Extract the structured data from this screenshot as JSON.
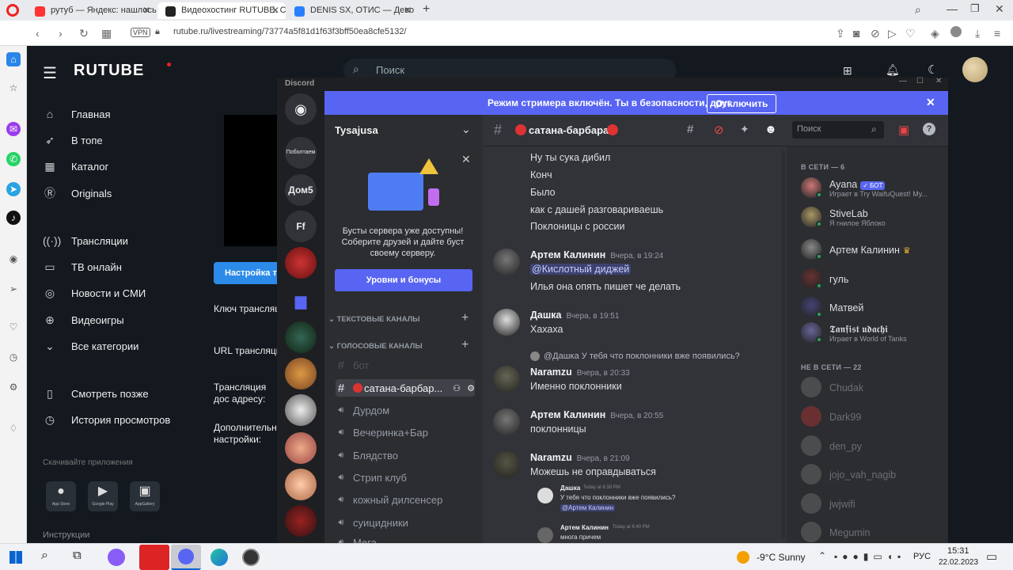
{
  "browser": {
    "tabs": [
      {
        "title": "рутуб — Яндекс: нашлось",
        "color": "#f33"
      },
      {
        "title": "Видеохостинг RUTUBE. Сm",
        "color": "#222"
      },
      {
        "title": "DENIS SX, ОТИС — Дево",
        "color": "#2a7fff"
      }
    ],
    "url": "rutube.ru/livestreaming/73774a5f81d1f63f3bff50ea8cfe5132/",
    "vpn": "VPN"
  },
  "rutube": {
    "logo": "RUTUBE",
    "search_placeholder": "Поиск",
    "nav": [
      {
        "label": "Главная",
        "icon": "home-icon",
        "glyph": "⌂"
      },
      {
        "label": "В топе",
        "icon": "rocket-icon",
        "glyph": "➶"
      },
      {
        "label": "Каталог",
        "icon": "grid-icon",
        "glyph": "▦"
      },
      {
        "label": "Originals",
        "icon": "originals-icon",
        "glyph": "Ⓡ"
      },
      {
        "label": "Трансляции",
        "icon": "broadcast-icon",
        "glyph": "((·))"
      },
      {
        "label": "ТВ онлайн",
        "icon": "live-tv-icon",
        "glyph": "▭"
      },
      {
        "label": "Новости и СМИ",
        "icon": "globe-icon",
        "glyph": "◎"
      },
      {
        "label": "Видеоигры",
        "icon": "gamepad-icon",
        "glyph": "⊕"
      },
      {
        "label": "Все категории",
        "icon": "chevron-down-icon",
        "glyph": "⌄"
      },
      {
        "label": "Смотреть позже",
        "icon": "bookmark-icon",
        "glyph": "▯"
      },
      {
        "label": "История просмотров",
        "icon": "history-icon",
        "glyph": "◷"
      }
    ],
    "apps_title": "Скачивайте приложения",
    "apps": [
      "App Store",
      "Google Play",
      "AppGallery"
    ],
    "instructions": "Инструкции",
    "settings_btn": "Настройка тр",
    "fields": [
      "Ключ трансляц",
      "URL трансляци",
      "Трансляция дос адресу:",
      "Дополнительн настройки:"
    ]
  },
  "discord": {
    "label": "Discord",
    "guilds": [
      "",
      "Поболтаем",
      "Дом5",
      "Ff",
      "",
      "",
      "",
      "",
      "",
      "",
      "",
      ""
    ],
    "banner_text": "Режим стримера включён. Ты в безопасности, друг.",
    "banner_button": "Отключить",
    "server_name": "Tysajusa",
    "boost_text": "Бусты сервера уже доступны! Соберите друзей и дайте буст своему серверу.",
    "boost_button": "Уровни и бонусы",
    "text_channels": "ТЕКСТОВЫЕ КАНАЛЫ",
    "voice_channels": "ГОЛОСОВЫЕ КАНАЛЫ",
    "channels": [
      "бот",
      "сатана-барбар...",
      "Дурдом",
      "Вечеринка+Бар",
      "Блядство",
      "Стрип клуб",
      "кожный дилсенсер",
      "суицидники",
      "Мега"
    ],
    "channel_title": "сатана-барбара",
    "search_placeholder": "Поиск",
    "messages_top": [
      "Ну ты сука дибил",
      "Конч",
      "Было",
      "как с дашей разговариваешь",
      "Поклоницы с россии"
    ],
    "messages": [
      {
        "author": "Артем Калинин",
        "time": "Вчера, в 19:24",
        "lines": [
          "@Кислотный диджей",
          "Илья она опять пишет че делать"
        ]
      },
      {
        "author": "Дашка",
        "time": "Вчера, в 19:51",
        "lines": [
          "Хахаха"
        ]
      },
      {
        "reply": "@Дашка У тебя что поклонники вже появились?",
        "author": "Naramzu",
        "time": "Вчера, в 20:33",
        "lines": [
          "Именно поклонники"
        ]
      },
      {
        "author": "Артем Калинин",
        "time": "Вчера, в 20:55",
        "lines": [
          "поклонницы"
        ]
      },
      {
        "author": "Naramzu",
        "time": "Вчера, в 21:09",
        "lines": [
          "Можешь не оправдываться"
        ]
      }
    ],
    "small_msgs": [
      {
        "author": "Дашка",
        "time": "Today at 6:38 PM",
        "lines": [
          "У тебя что поклонники вже появились?",
          "@Артем Калинин"
        ]
      },
      {
        "author": "Артем Калинин",
        "time": "Today at 6:40 PM",
        "lines": [
          "многа причем"
        ]
      }
    ],
    "online_title": "В СЕТИ — 6",
    "online": [
      {
        "name": "Ayana",
        "status": "Играет в Try WaifuQuest! My...",
        "badge": "✓ БОТ",
        "color": "#c77"
      },
      {
        "name": "StiveLab",
        "status": "Я гнилое Яблоко",
        "badge": "",
        "color": "#a96"
      },
      {
        "name": "Артем Калинин",
        "status": "",
        "badge": "♛",
        "color": "#888"
      },
      {
        "name": "гуль",
        "status": "",
        "badge": "",
        "color": "#633"
      },
      {
        "name": "Матвей",
        "status": "",
        "badge": "",
        "color": "#447"
      },
      {
        "name": "𝕿𝖆𝖓𝖋𝖎𝖘𝖙 𝖚𝖉𝖆𝖈𝖍𝖎",
        "status": "Играет в World of Tanks",
        "badge": "",
        "color": "#669"
      }
    ],
    "offline_title": "НЕ В СЕТИ — 22",
    "offline": [
      "Chudak",
      "Dark99",
      "den_py",
      "jojo_vah_nagib",
      "jwjwifi",
      "Megumin"
    ]
  },
  "taskbar": {
    "weather": "-9°C  Sunny",
    "lang": "РУС",
    "time": "15:31",
    "date": "22.02.2023"
  }
}
